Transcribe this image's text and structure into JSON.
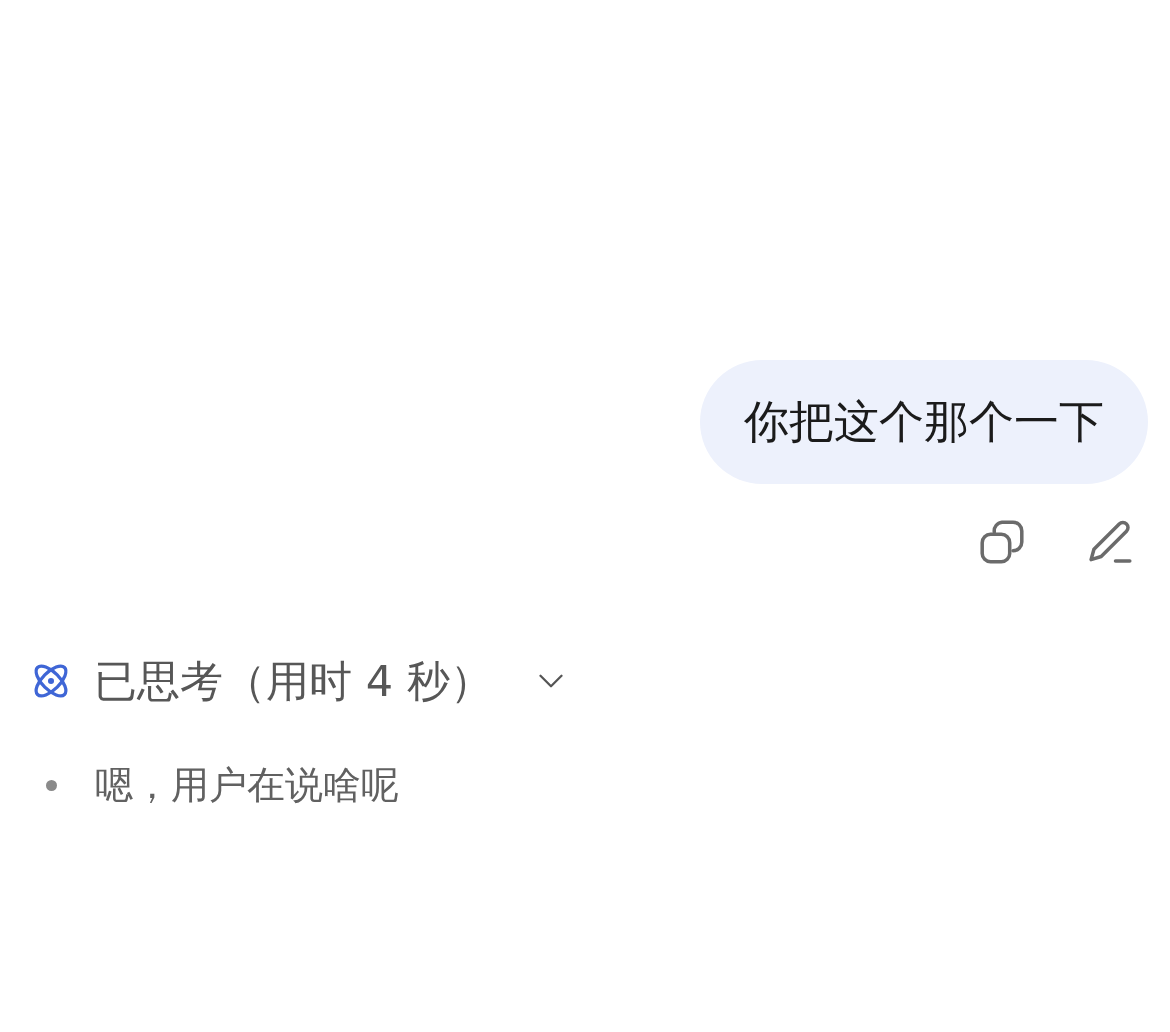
{
  "user_message": {
    "text": "你把这个那个一下"
  },
  "message_actions": [
    {
      "kind": "copy"
    },
    {
      "kind": "edit"
    }
  ],
  "thinking": {
    "label": "已思考（用时 4 秒）",
    "expanded": true,
    "steps": [
      {
        "text": "嗯，用户在说啥呢"
      }
    ]
  }
}
